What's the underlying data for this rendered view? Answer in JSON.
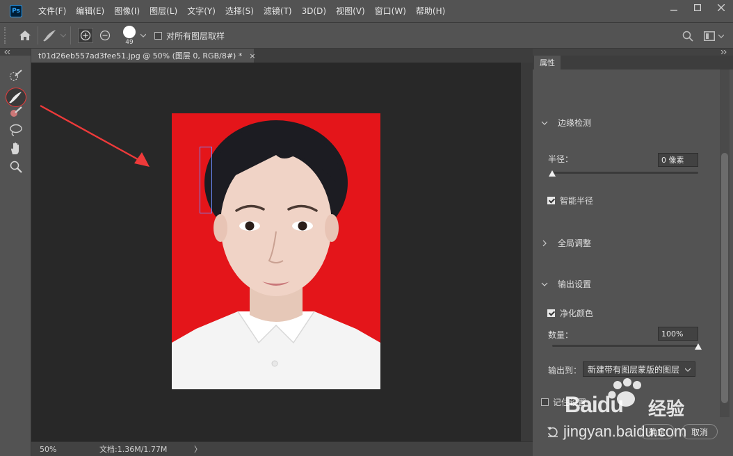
{
  "app": {
    "logo_text": "Ps"
  },
  "menu": {
    "items": [
      "文件(F)",
      "编辑(E)",
      "图像(I)",
      "图层(L)",
      "文字(Y)",
      "选择(S)",
      "滤镜(T)",
      "3D(D)",
      "视图(V)",
      "窗口(W)",
      "帮助(H)"
    ]
  },
  "options_bar": {
    "brush_size": "49",
    "sample_all_layers_label": "对所有图层取样",
    "sample_all_layers_checked": false
  },
  "document": {
    "tab_title": "t01d26eb557ad3fee51.jpg @ 50% (图层 0, RGB/8#) *",
    "close_glyph": "×",
    "zoom": "50%",
    "doc_size": "文档:1.36M/1.77M",
    "status_arrow": "〉"
  },
  "properties": {
    "tab_label": "属性",
    "edge_detection": {
      "title": "边缘检测",
      "radius_label": "半径：",
      "radius_value": "0 像素",
      "radius_level": 0,
      "smart_radius_label": "智能半径",
      "smart_radius_checked": true
    },
    "global_refine": {
      "title": "全局调整"
    },
    "output": {
      "title": "输出设置",
      "decontaminate_label": "净化颜色",
      "decontaminate_checked": true,
      "amount_label": "数量：",
      "amount_value": "100%",
      "amount_level": 1.0,
      "output_to_label": "输出到：",
      "output_to_value": "新建带有图层蒙版的图层"
    },
    "remember_label": "记住设置",
    "remember_checked": false,
    "ok_label": "确定",
    "cancel_label": "取消"
  },
  "watermark": {
    "brand": "Baidu",
    "brand_cn": "经验",
    "url": "jingyan.baidu.com"
  },
  "colors": {
    "ui_bg": "#535353",
    "canvas_bg": "#282828",
    "photo_red": "#e4151a",
    "arrow_red": "#ee3a3a",
    "selection_blue": "#6e8dff"
  },
  "icons": {
    "home": "home-icon",
    "brush": "brush-icon",
    "add": "add-to-selection-icon",
    "subtract": "subtract-from-selection-icon",
    "search": "search-icon",
    "workspace": "workspace-icon"
  }
}
